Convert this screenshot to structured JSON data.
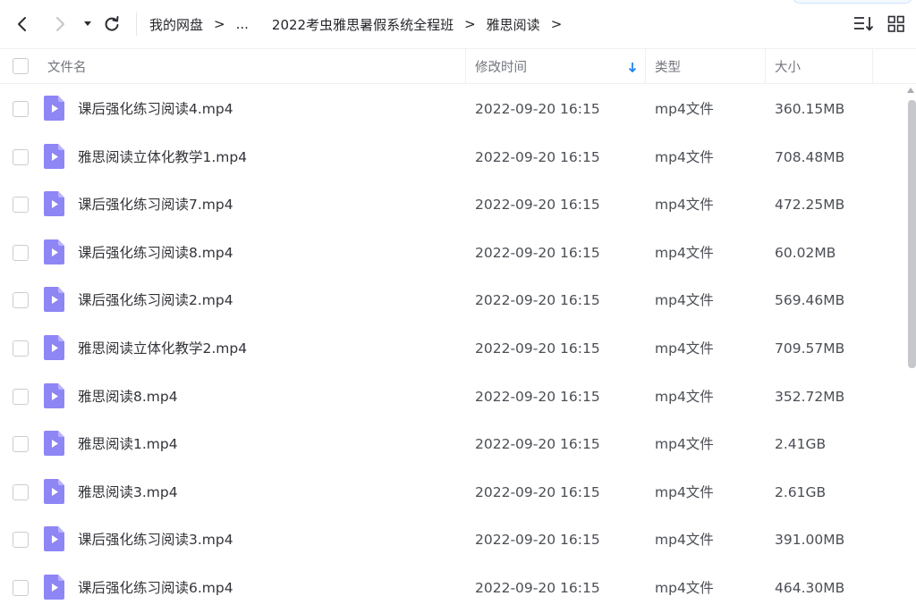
{
  "nav": {
    "back_icon": "chevron-left-icon",
    "forward_icon": "chevron-right-icon",
    "dropdown_icon": "caret-down-icon",
    "refresh_icon": "refresh-icon"
  },
  "breadcrumb": {
    "items": [
      "我的网盘",
      "...",
      "2022考虫雅思暑假系统全程班",
      "雅思阅读"
    ],
    "separator": ">"
  },
  "toolbar": {
    "sort_icon": "sort-list-icon",
    "view_icon": "grid-view-icon"
  },
  "table": {
    "columns": {
      "name": "文件名",
      "modified": "修改时间",
      "type": "类型",
      "size": "大小"
    },
    "sort_indicator": "sort-descending-arrow-icon",
    "rows": [
      {
        "name": "课后强化练习阅读4.mp4",
        "modified": "2022-09-20 16:15",
        "type": "mp4文件",
        "size": "360.15MB"
      },
      {
        "name": "雅思阅读立体化教学1.mp4",
        "modified": "2022-09-20 16:15",
        "type": "mp4文件",
        "size": "708.48MB"
      },
      {
        "name": "课后强化练习阅读7.mp4",
        "modified": "2022-09-20 16:15",
        "type": "mp4文件",
        "size": "472.25MB"
      },
      {
        "name": "课后强化练习阅读8.mp4",
        "modified": "2022-09-20 16:15",
        "type": "mp4文件",
        "size": "60.02MB"
      },
      {
        "name": "课后强化练习阅读2.mp4",
        "modified": "2022-09-20 16:15",
        "type": "mp4文件",
        "size": "569.46MB"
      },
      {
        "name": "雅思阅读立体化教学2.mp4",
        "modified": "2022-09-20 16:15",
        "type": "mp4文件",
        "size": "709.57MB"
      },
      {
        "name": "雅思阅读8.mp4",
        "modified": "2022-09-20 16:15",
        "type": "mp4文件",
        "size": "352.72MB"
      },
      {
        "name": "雅思阅读1.mp4",
        "modified": "2022-09-20 16:15",
        "type": "mp4文件",
        "size": "2.41GB"
      },
      {
        "name": "雅思阅读3.mp4",
        "modified": "2022-09-20 16:15",
        "type": "mp4文件",
        "size": "2.61GB"
      },
      {
        "name": "课后强化练习阅读3.mp4",
        "modified": "2022-09-20 16:15",
        "type": "mp4文件",
        "size": "391.00MB"
      },
      {
        "name": "课后强化练习阅读6.mp4",
        "modified": "2022-09-20 16:15",
        "type": "mp4文件",
        "size": "464.30MB"
      }
    ]
  },
  "colors": {
    "accent": "#1a86f0",
    "video_icon": "#8e86f5",
    "video_icon_fold": "#b9b3fa"
  }
}
